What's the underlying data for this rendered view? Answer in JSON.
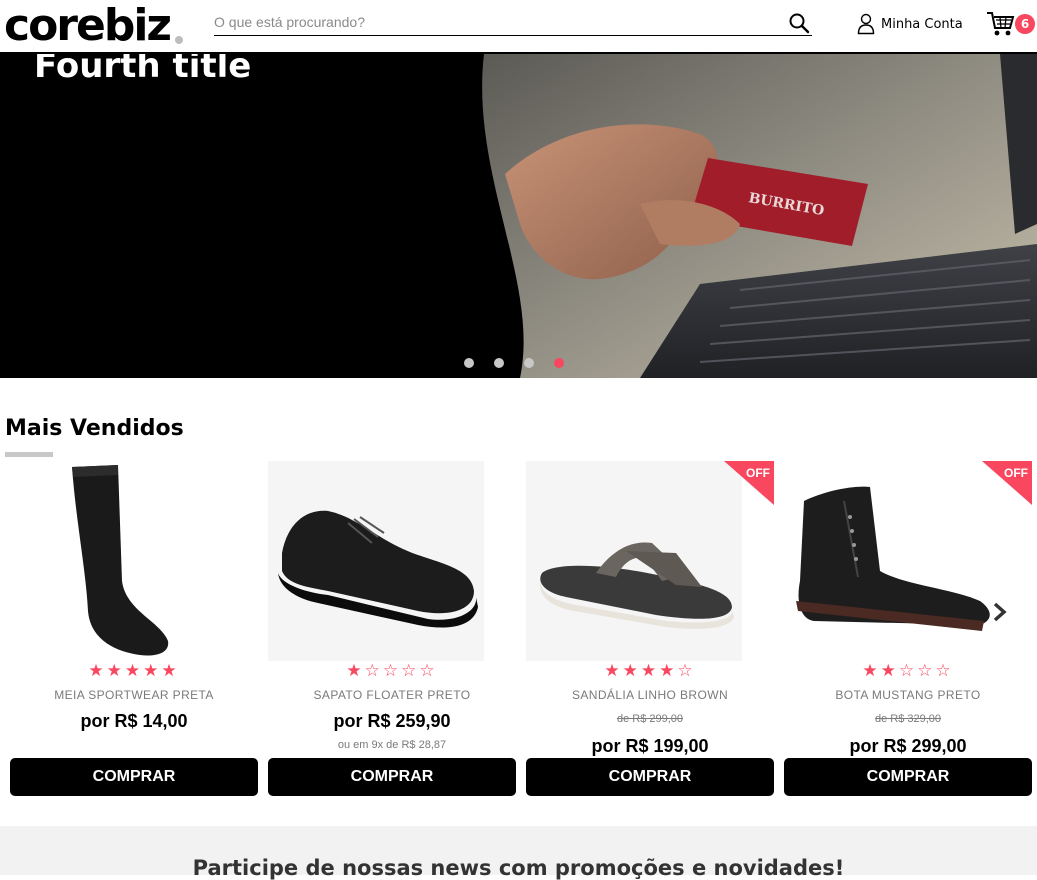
{
  "header": {
    "logo": "corebiz",
    "search_placeholder": "O que está procurando?",
    "account_label": "Minha Conta",
    "cart_count": "6",
    "icons": [
      "search-icon",
      "user-icon",
      "cart-icon"
    ]
  },
  "banner": {
    "title": "Fourth title",
    "slides": 4,
    "active_slide": 4,
    "card_text": "BURRITO"
  },
  "section": {
    "title": "Mais Vendidos"
  },
  "products": [
    {
      "name": "MEIA SPORTWEAR PRETA",
      "rating": 5,
      "stars": "★★★★★",
      "old_price": "",
      "price": "por R$ 14,00",
      "installments": "",
      "off": false,
      "button": "COMPRAR"
    },
    {
      "name": "SAPATO FLOATER PRETO",
      "rating": 1,
      "stars": "★☆☆☆☆",
      "old_price": "",
      "price": "por R$ 259,90",
      "installments": "ou em 9x de R$ 28,87",
      "off": false,
      "button": "COMPRAR"
    },
    {
      "name": "SANDÁLIA LINHO BROWN",
      "rating": 4,
      "stars": "★★★★☆",
      "old_price": "de R$ 299,00",
      "price": "por R$ 199,00",
      "installments": "",
      "off": true,
      "off_label": "OFF",
      "button": "COMPRAR"
    },
    {
      "name": "BOTA MUSTANG PRETO",
      "rating": 2,
      "stars": "★★☆☆☆",
      "old_price": "de R$ 329,00",
      "price": "por R$ 299,00",
      "installments": "",
      "off": true,
      "off_label": "OFF",
      "button": "COMPRAR"
    }
  ],
  "newsletter": {
    "title": "Participe de nossas news com promoções e novidades!"
  },
  "colors": {
    "accent": "#f8475f",
    "button": "#000000",
    "muted": "#7a7a7a"
  }
}
